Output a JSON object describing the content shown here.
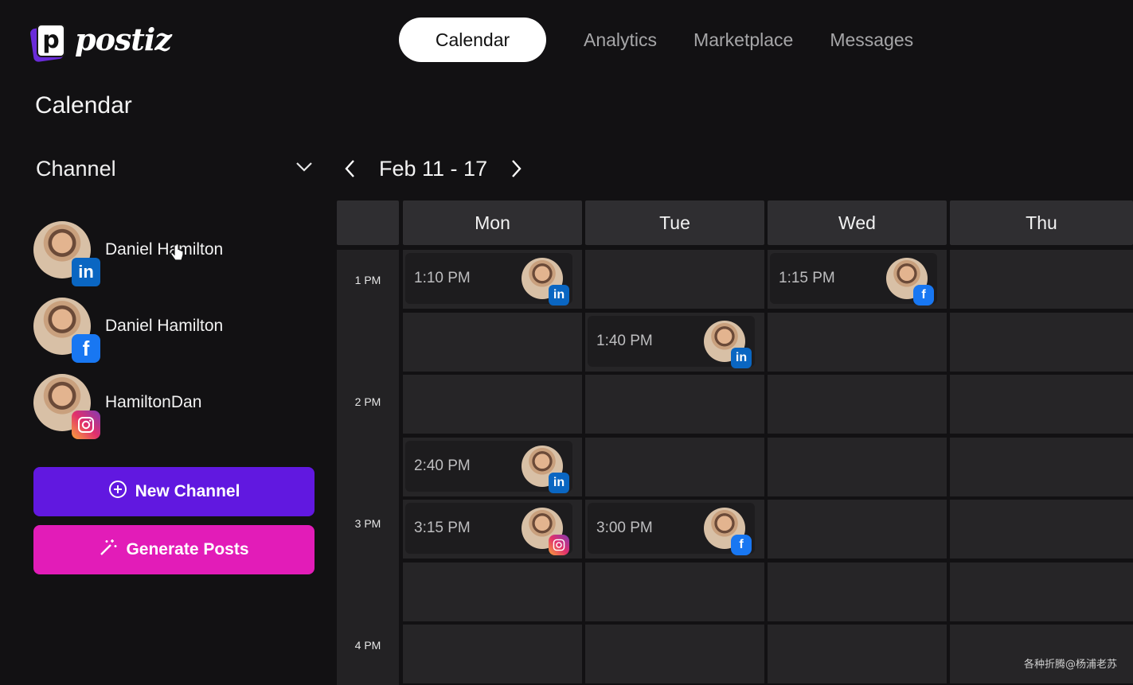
{
  "app": {
    "brand": "postiz",
    "logo_letter": "p"
  },
  "nav": {
    "tabs": [
      "Calendar",
      "Analytics",
      "Marketplace",
      "Messages"
    ],
    "active": "Calendar"
  },
  "page": {
    "title": "Calendar"
  },
  "channel_select": {
    "label": "Channel"
  },
  "channels": [
    {
      "name": "Daniel Hamilton",
      "platform": "linkedin"
    },
    {
      "name": "Daniel Hamilton",
      "platform": "facebook"
    },
    {
      "name": "HamiltonDan",
      "platform": "instagram"
    }
  ],
  "buttons": {
    "new_channel": "New Channel",
    "generate_posts": "Generate Posts"
  },
  "week": {
    "label": "Feb 11 - 17"
  },
  "days": [
    "Mon",
    "Tue",
    "Wed",
    "Thu"
  ],
  "times": [
    "1 PM",
    "2 PM",
    "3 PM",
    "4 PM"
  ],
  "posts": [
    {
      "time": "1:10 PM",
      "day": "Mon",
      "platform": "linkedin"
    },
    {
      "time": "1:15 PM",
      "day": "Wed",
      "platform": "facebook"
    },
    {
      "time": "1:40 PM",
      "day": "Tue",
      "platform": "linkedin"
    },
    {
      "time": "2:40 PM",
      "day": "Mon",
      "platform": "linkedin"
    },
    {
      "time": "3:00 PM",
      "day": "Tue",
      "platform": "facebook"
    },
    {
      "time": "3:15 PM",
      "day": "Mon",
      "platform": "instagram"
    }
  ],
  "watermark": "各种折腾@杨浦老苏",
  "colors": {
    "primary": "#6118e0",
    "accent": "#e21cb8",
    "background": "#121113"
  }
}
